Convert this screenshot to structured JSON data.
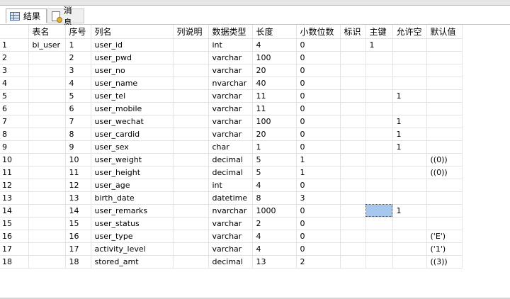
{
  "tabs": [
    {
      "label": "结果",
      "icon": "results-grid-icon",
      "active": true
    },
    {
      "label": "消息",
      "icon": "messages-icon",
      "active": false
    }
  ],
  "grid": {
    "columns": [
      "表名",
      "序号",
      "列名",
      "列说明",
      "数据类型",
      "长度",
      "小数位数",
      "标识",
      "主键",
      "允许空",
      "默认值"
    ],
    "rows": [
      {
        "n": "1",
        "cells": [
          "bi_user",
          "1",
          "user_id",
          "",
          "int",
          "4",
          "0",
          "",
          "1",
          "",
          ""
        ]
      },
      {
        "n": "2",
        "cells": [
          "",
          "2",
          "user_pwd",
          "",
          "varchar",
          "100",
          "0",
          "",
          "",
          "",
          ""
        ]
      },
      {
        "n": "3",
        "cells": [
          "",
          "3",
          "user_no",
          "",
          "varchar",
          "20",
          "0",
          "",
          "",
          "",
          ""
        ]
      },
      {
        "n": "4",
        "cells": [
          "",
          "4",
          "user_name",
          "",
          "nvarchar",
          "40",
          "0",
          "",
          "",
          "",
          ""
        ]
      },
      {
        "n": "5",
        "cells": [
          "",
          "5",
          "user_tel",
          "",
          "varchar",
          "11",
          "0",
          "",
          "",
          "1",
          ""
        ]
      },
      {
        "n": "6",
        "cells": [
          "",
          "6",
          "user_mobile",
          "",
          "varchar",
          "11",
          "0",
          "",
          "",
          "",
          ""
        ]
      },
      {
        "n": "7",
        "cells": [
          "",
          "7",
          "user_wechat",
          "",
          "varchar",
          "100",
          "0",
          "",
          "",
          "1",
          ""
        ]
      },
      {
        "n": "8",
        "cells": [
          "",
          "8",
          "user_cardid",
          "",
          "varchar",
          "20",
          "0",
          "",
          "",
          "1",
          ""
        ]
      },
      {
        "n": "9",
        "cells": [
          "",
          "9",
          "user_sex",
          "",
          "char",
          "1",
          "0",
          "",
          "",
          "1",
          ""
        ]
      },
      {
        "n": "10",
        "cells": [
          "",
          "10",
          "user_weight",
          "",
          "decimal",
          "5",
          "1",
          "",
          "",
          "",
          "((0))"
        ]
      },
      {
        "n": "11",
        "cells": [
          "",
          "11",
          "user_height",
          "",
          "decimal",
          "5",
          "1",
          "",
          "",
          "",
          "((0))"
        ]
      },
      {
        "n": "12",
        "cells": [
          "",
          "12",
          "user_age",
          "",
          "int",
          "4",
          "0",
          "",
          "",
          "",
          ""
        ]
      },
      {
        "n": "13",
        "cells": [
          "",
          "13",
          "birth_date",
          "",
          "datetime",
          "8",
          "3",
          "",
          "",
          "",
          ""
        ]
      },
      {
        "n": "14",
        "cells": [
          "",
          "14",
          "user_remarks",
          "",
          "nvarchar",
          "1000",
          "0",
          "",
          "",
          "1",
          ""
        ]
      },
      {
        "n": "15",
        "cells": [
          "",
          "15",
          "user_status",
          "",
          "varchar",
          "2",
          "0",
          "",
          "",
          "",
          ""
        ]
      },
      {
        "n": "16",
        "cells": [
          "",
          "16",
          "user_type",
          "",
          "varchar",
          "4",
          "0",
          "",
          "",
          "",
          "('E')"
        ]
      },
      {
        "n": "17",
        "cells": [
          "",
          "17",
          "activity_level",
          "",
          "varchar",
          "4",
          "0",
          "",
          "",
          "",
          "('1')"
        ]
      },
      {
        "n": "18",
        "cells": [
          "",
          "18",
          "stored_amt",
          "",
          "decimal",
          "13",
          "2",
          "",
          "",
          "",
          "((3))"
        ]
      }
    ],
    "selected_cell": {
      "row": 14,
      "column": "主键"
    },
    "selection_color": "#a7c8ee"
  }
}
